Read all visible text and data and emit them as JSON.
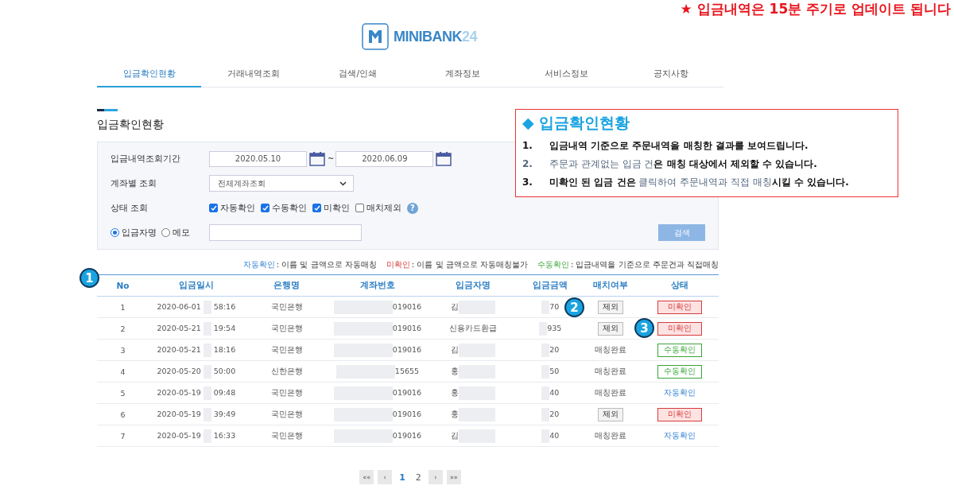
{
  "notice": "★ 입금내역은 15분 주기로 업데이트 됩니다",
  "logo": {
    "text": "MINIBANK",
    "number": "24"
  },
  "tabs": [
    {
      "label": "입금확인현황",
      "selected": true
    },
    {
      "label": "거래내역조회",
      "selected": false
    },
    {
      "label": "검색/인쇄",
      "selected": false
    },
    {
      "label": "계좌정보",
      "selected": false
    },
    {
      "label": "서비스정보",
      "selected": false
    },
    {
      "label": "공지사항",
      "selected": false
    }
  ],
  "section_title": "입금확인현황",
  "filters": {
    "period": {
      "label": "입금내역조회기간",
      "from": "2020.05.10",
      "separator": "~",
      "to": "2020.06.09"
    },
    "account": {
      "label": "계좌별 조회",
      "value": "전체계좌조회"
    },
    "status": {
      "label": "상태 조회",
      "options": [
        {
          "label": "자동확인",
          "checked": true
        },
        {
          "label": "수동확인",
          "checked": true
        },
        {
          "label": "미확인",
          "checked": true
        },
        {
          "label": "매치제외",
          "checked": false
        }
      ],
      "help": "?"
    },
    "search_by": [
      {
        "label": "입금자명",
        "selected": true
      },
      {
        "label": "메모",
        "selected": false
      }
    ],
    "search_button": "검색"
  },
  "info_box": {
    "title": "◆ 입금확인현황",
    "items": [
      {
        "number": "1.",
        "text": "**입금내역 기준으로 주문내역을 매칭한 결과를 보여드립니다.**",
        "muted_number": false
      },
      {
        "number": "2.",
        "text": "주문과 관계없는 입금 건**은 매칭 대상에서 제외할 수 있습니다.**",
        "muted_number": true
      },
      {
        "number": "3.",
        "text": "**미확인 된 입금 건은** 클릭하여 주문내역과 직접 매칭**시킬 수 있습니다.**",
        "muted_number": false
      }
    ]
  },
  "legend": [
    {
      "term": "자동확인",
      "kind": "auto",
      "desc": ": 이름 및 금액으로 자동매칭"
    },
    {
      "term": "미확인",
      "kind": "unconfirmed",
      "desc": ": 이름 및 금액으로 자동매칭불가"
    },
    {
      "term": "수동확인",
      "kind": "manual",
      "desc": ": 입금내역을 기준으로 주문건과 직접매칭"
    }
  ],
  "table": {
    "columns": [
      "No",
      "입금일시",
      "은행명",
      "계좌번호",
      "입금자명",
      "입금금액",
      "매치여부",
      "상태"
    ],
    "rows": [
      {
        "no": "1",
        "date": "2020-06-01",
        "time": "58:16",
        "bank": "국민은행",
        "account": "019016",
        "name": "김",
        "name_masked": true,
        "amount": "70",
        "match": {
          "kind": "button",
          "label": "제외"
        },
        "status": {
          "kind": "unconfirmed",
          "label": "미확인"
        }
      },
      {
        "no": "2",
        "date": "2020-05-21",
        "time": "19:54",
        "bank": "국민은행",
        "account": "019016",
        "name": "신용카드환급",
        "name_masked": false,
        "amount": "935",
        "match": {
          "kind": "button",
          "label": "제외"
        },
        "status": {
          "kind": "unconfirmed",
          "label": "미확인"
        }
      },
      {
        "no": "3",
        "date": "2020-05-21",
        "time": "18:16",
        "bank": "국민은행",
        "account": "019016",
        "name": "김",
        "name_masked": true,
        "amount": "20",
        "match": {
          "kind": "text",
          "label": "매칭완료"
        },
        "status": {
          "kind": "manual",
          "label": "수동확인"
        }
      },
      {
        "no": "4",
        "date": "2020-05-20",
        "time": "50:00",
        "bank": "신한은행",
        "account": "15655",
        "name": "홍",
        "name_masked": true,
        "amount": "50",
        "match": {
          "kind": "text",
          "label": "매칭완료"
        },
        "status": {
          "kind": "manual",
          "label": "수동확인"
        }
      },
      {
        "no": "5",
        "date": "2020-05-19",
        "time": "09:48",
        "bank": "국민은행",
        "account": "019016",
        "name": "홍",
        "name_masked": true,
        "amount": "40",
        "match": {
          "kind": "text",
          "label": "매칭완료"
        },
        "status": {
          "kind": "auto",
          "label": "자동확인"
        }
      },
      {
        "no": "6",
        "date": "2020-05-19",
        "time": "39:49",
        "bank": "국민은행",
        "account": "019016",
        "name": "홍",
        "name_masked": true,
        "amount": "20",
        "match": {
          "kind": "button",
          "label": "제외"
        },
        "status": {
          "kind": "unconfirmed",
          "label": "미확인"
        }
      },
      {
        "no": "7",
        "date": "2020-05-19",
        "time": "16:33",
        "bank": "국민은행",
        "account": "019016",
        "name": "김",
        "name_masked": true,
        "amount": "40",
        "match": {
          "kind": "text",
          "label": "매칭완료"
        },
        "status": {
          "kind": "auto",
          "label": "자동확인"
        }
      }
    ]
  },
  "pagination": {
    "first": "««",
    "prev": "‹",
    "pages": [
      {
        "label": "1",
        "selected": true
      },
      {
        "label": "2",
        "selected": false
      }
    ],
    "next": "›",
    "last": "»»"
  },
  "callouts": [
    "1",
    "2",
    "3"
  ]
}
